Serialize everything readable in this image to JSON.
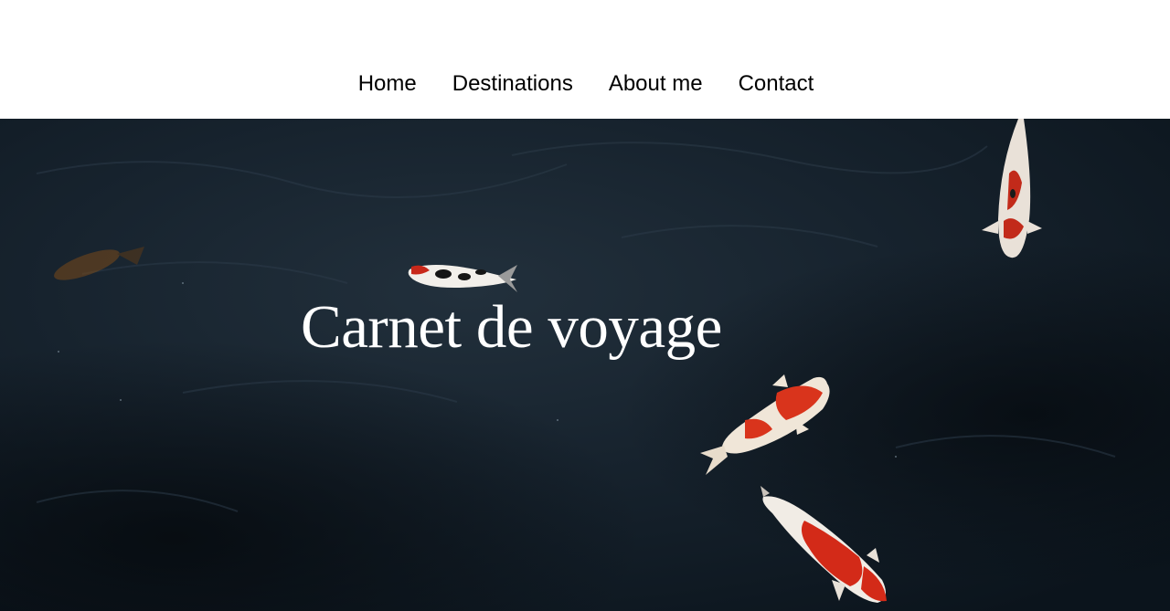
{
  "nav": {
    "items": [
      {
        "label": "Home"
      },
      {
        "label": "Destinations"
      },
      {
        "label": "About me"
      },
      {
        "label": "Contact"
      }
    ]
  },
  "hero": {
    "title": "Carnet de voyage",
    "image_subject": "koi-fish-pond"
  },
  "colors": {
    "header_bg": "#ffffff",
    "nav_text": "#000000",
    "water_dark": "#0e1a24",
    "title_text": "#ffffff"
  }
}
